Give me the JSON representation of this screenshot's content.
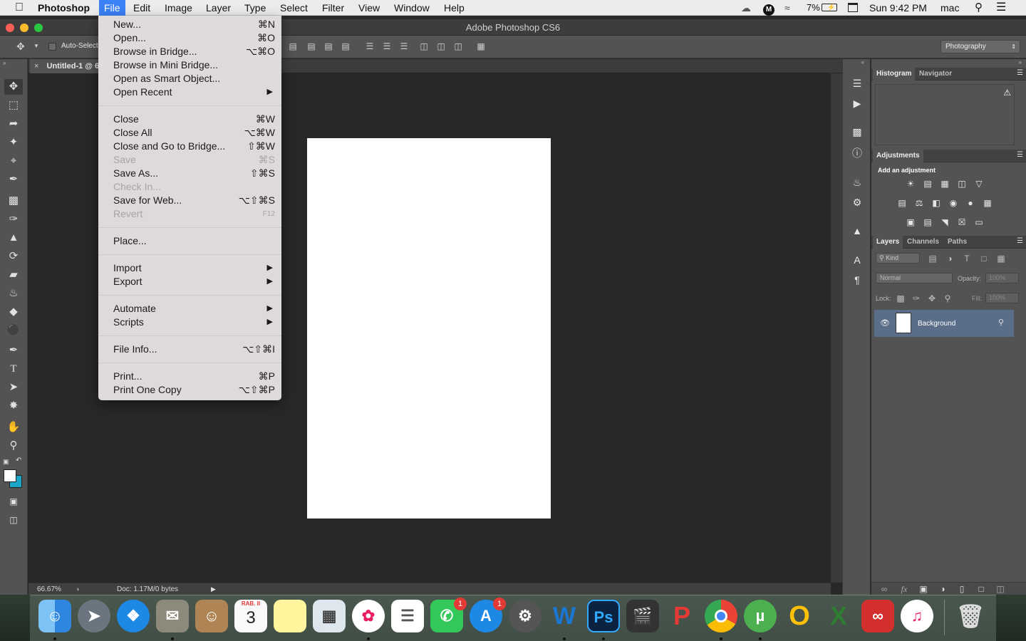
{
  "menubar": {
    "apple": "",
    "app_name": "Photoshop",
    "items": [
      "File",
      "Edit",
      "Image",
      "Layer",
      "Type",
      "Select",
      "Filter",
      "View",
      "Window",
      "Help"
    ],
    "battery": "7%",
    "clock": "Sun 9:42 PM",
    "user": "mac"
  },
  "window": {
    "title": "Adobe Photoshop CS6"
  },
  "options": {
    "auto_select": "Auto-Select",
    "workspace": "Photography"
  },
  "document": {
    "tab_label": "Untitled-1 @ 6",
    "zoom": "66.67%",
    "doc_info": "Doc: 1.17M/0 bytes"
  },
  "file_menu": {
    "items": [
      {
        "label": "New...",
        "shortcut": "⌘N"
      },
      {
        "label": "Open...",
        "shortcut": "⌘O"
      },
      {
        "label": "Browse in Bridge...",
        "shortcut": "⌥⌘O"
      },
      {
        "label": "Browse in Mini Bridge...",
        "shortcut": ""
      },
      {
        "label": "Open as Smart Object...",
        "shortcut": ""
      },
      {
        "label": "Open Recent",
        "shortcut": "▶"
      },
      {
        "label": "Close",
        "shortcut": "⌘W"
      },
      {
        "label": "Close All",
        "shortcut": "⌥⌘W"
      },
      {
        "label": "Close and Go to Bridge...",
        "shortcut": "⇧⌘W"
      },
      {
        "label": "Save",
        "shortcut": "⌘S"
      },
      {
        "label": "Save As...",
        "shortcut": "⇧⌘S"
      },
      {
        "label": "Check In...",
        "shortcut": ""
      },
      {
        "label": "Save for Web...",
        "shortcut": "⌥⇧⌘S"
      },
      {
        "label": "Revert",
        "shortcut": "F12"
      },
      {
        "label": "Place...",
        "shortcut": ""
      },
      {
        "label": "Import",
        "shortcut": "▶"
      },
      {
        "label": "Export",
        "shortcut": "▶"
      },
      {
        "label": "Automate",
        "shortcut": "▶"
      },
      {
        "label": "Scripts",
        "shortcut": "▶"
      },
      {
        "label": "File Info...",
        "shortcut": "⌥⇧⌘I"
      },
      {
        "label": "Print...",
        "shortcut": "⌘P"
      },
      {
        "label": "Print One Copy",
        "shortcut": "⌥⇧⌘P"
      }
    ]
  },
  "panels": {
    "histogram_tab": "Histogram",
    "navigator_tab": "Navigator",
    "adjustments_tab": "Adjustments",
    "add_adjustment": "Add an adjustment",
    "layers_tab": "Layers",
    "channels_tab": "Channels",
    "paths_tab": "Paths",
    "kind": "Kind",
    "blend_mode": "Normal",
    "opacity_label": "Opacity:",
    "opacity_value": "100%",
    "lock_label": "Lock:",
    "fill_label": "Fill:",
    "fill_value": "100%",
    "layer_name": "Background"
  },
  "dock": {
    "calendar_month": "RAB. II",
    "calendar_day": "3",
    "facetime_badge": "1",
    "appstore_badge": "1"
  }
}
